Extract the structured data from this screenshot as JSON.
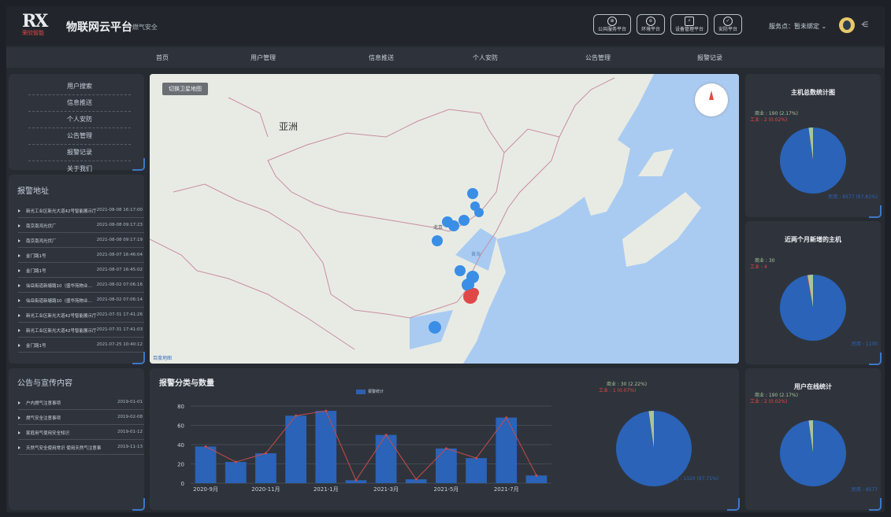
{
  "header": {
    "logo_text": "RX",
    "logo_sub": "荣欣智能",
    "title": "物联网云平台",
    "subtitle": "-燃气安全",
    "platforms": [
      {
        "icon": "globe-icon",
        "label": "公共服务平台"
      },
      {
        "icon": "message-icon",
        "label": "环境平台"
      },
      {
        "icon": "flash-icon",
        "label": "设备管理平台"
      },
      {
        "icon": "shield-icon",
        "label": "安防平台"
      }
    ],
    "service": "服务点：暂未绑定 ⌄",
    "share_icon": "share-icon"
  },
  "nav": [
    "首页",
    "用户管理",
    "信息推送",
    "个人安防",
    "公告管理",
    "报警记录"
  ],
  "sidebar_menu": [
    "用户搜索",
    "信息推送",
    "个人安防",
    "公告管理",
    "报警记录",
    "关于我们"
  ],
  "alarm": {
    "title": "报警地址",
    "items": [
      {
        "text": "新光工业区新光大道42号智能展示厅",
        "time": "2021-08-08 16:17:00"
      },
      {
        "text": "南京南鸿光伏厂",
        "time": "2021-08-08 09:17:23"
      },
      {
        "text": "南京南鸿光伏厂",
        "time": "2021-08-08 09:17:19"
      },
      {
        "text": "金门路1号",
        "time": "2021-08-07 16:46:04"
      },
      {
        "text": "金门路1号",
        "time": "2021-08-07 16:45:02"
      },
      {
        "text": "仙岳街道新塘路10（盛华苑物业…",
        "time": "2021-08-02 07:06:16"
      },
      {
        "text": "仙岳街道新塘路10（盛华苑物业…",
        "time": "2021-08-02 07:06:14"
      },
      {
        "text": "新光工业区新光大道42号智能展示厅",
        "time": "2021-07-31 17:41:26"
      },
      {
        "text": "新光工业区新光大道42号智能展示厅",
        "time": "2021-07-31 17:41:03"
      },
      {
        "text": "金门路1号",
        "time": "2021-07-25 10:40:12"
      }
    ]
  },
  "notice": {
    "title": "公告与宣传内容",
    "items": [
      {
        "text": "户内燃气注意事项",
        "time": "2019-01-01"
      },
      {
        "text": "燃气安全注意事项",
        "time": "2019-02-08"
      },
      {
        "text": "家庭用气使用安全知识",
        "time": "2019-01-12"
      },
      {
        "text": "天然气安全使用常识 使用天然气注意事项",
        "time": "2019-11-13"
      }
    ]
  },
  "map": {
    "switch_label": "切换卫星地图",
    "asia": "亚洲",
    "beijing": "北京",
    "sea": "黄海",
    "attribution": "百度地图"
  },
  "chart_data": [
    {
      "type": "bar",
      "title": "报警分类与数量",
      "legend": "报警统计",
      "categories": [
        "2020-9月",
        "2020-10月",
        "2020-11月",
        "2020-12月",
        "2021-1月",
        "2021-2月",
        "2021-3月",
        "2021-4月",
        "2021-5月",
        "2021-6月",
        "2021-7月",
        "2021-8月"
      ],
      "x_tick_labels": [
        "2020-9月",
        "2020-11月",
        "2021-1月",
        "2021-3月",
        "2021-5月",
        "2021-7月"
      ],
      "series": [
        {
          "name": "报警统计",
          "type": "bar",
          "values": [
            38,
            22,
            31,
            70,
            75,
            3,
            50,
            4,
            36,
            26,
            68,
            8
          ]
        },
        {
          "type": "line",
          "values": [
            38,
            22,
            31,
            70,
            75,
            3,
            50,
            4,
            36,
            26,
            68,
            8
          ]
        }
      ],
      "ylim": [
        0,
        80
      ],
      "yticks": [
        0,
        20,
        40,
        60,
        80
      ]
    },
    {
      "type": "pie",
      "labels": [
        "商业 : 30 (2.22%)",
        "工业 : 1 (0.07%)",
        "民用 : 1320 (97.71%)"
      ],
      "values": [
        30,
        1,
        1320
      ],
      "colors": [
        "#a8c59a",
        "#e04848",
        "#2a63b8"
      ]
    },
    {
      "type": "pie",
      "title": "主机总数统计图",
      "labels": [
        "商业 : 190 (2.17%)",
        "工业 : 2 (0.02%)",
        "民用 : 8577 (97.81%)"
      ],
      "values": [
        190,
        2,
        8577
      ],
      "colors": [
        "#a8c59a",
        "#e04848",
        "#2a63b8"
      ]
    },
    {
      "type": "pie",
      "title": "近两个月新增的主机",
      "labels": [
        "商业 : 30",
        "工业 : 4",
        "民用 : 1100"
      ],
      "values": [
        30,
        4,
        1100
      ],
      "colors": [
        "#a8c59a",
        "#e04848",
        "#2a63b8"
      ]
    },
    {
      "type": "pie",
      "title": "用户在线统计",
      "labels": [
        "商业 : 190 (2.17%)",
        "工业 : 2 (0.02%)",
        "民用 : 8577"
      ],
      "values": [
        190,
        2,
        8577
      ],
      "colors": [
        "#a8c59a",
        "#e04848",
        "#2a63b8"
      ]
    }
  ],
  "colors": {
    "bar": "#2a63b8",
    "line": "#c94a4a",
    "panel": "#2f343c",
    "accent": "#3d78c9"
  }
}
